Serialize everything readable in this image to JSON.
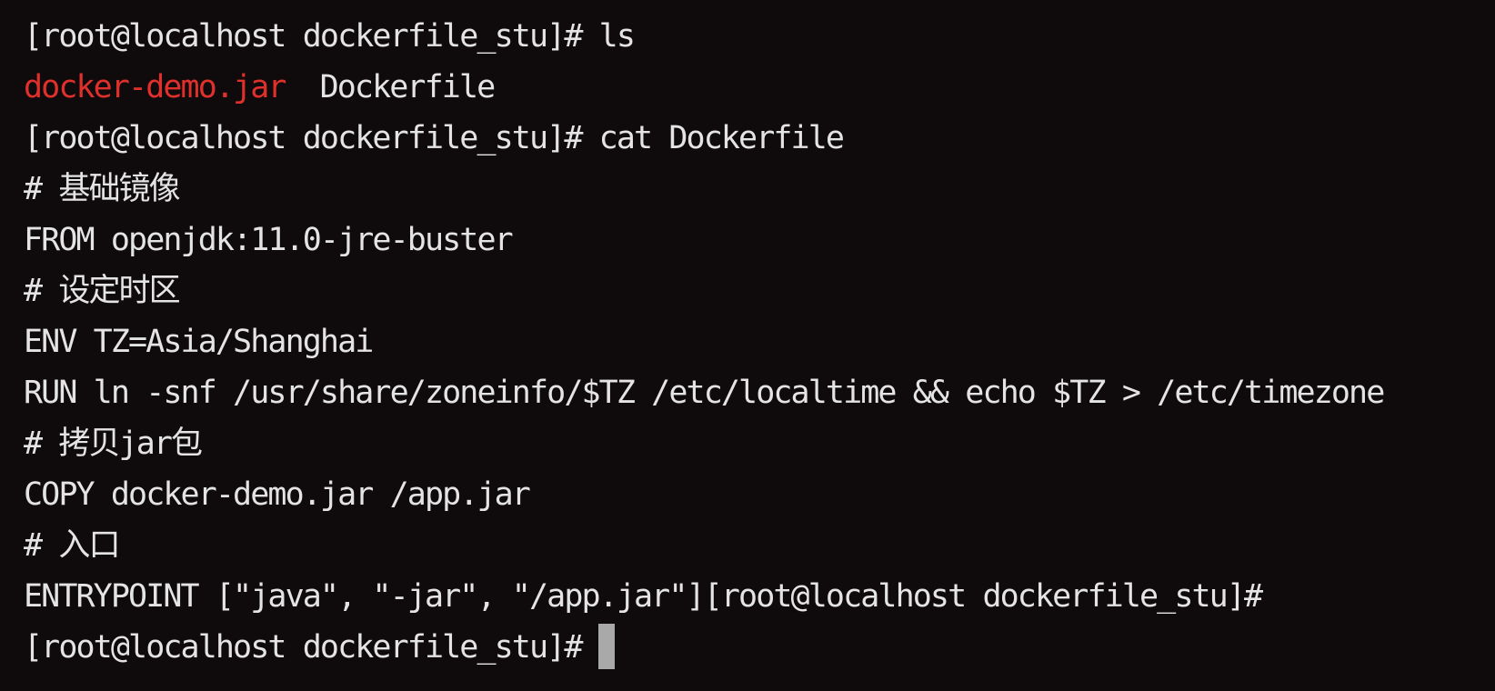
{
  "terminal": {
    "lines": [
      "[root@localhost dockerfile_stu]# ls",
      "docker-demo.jar",
      "Dockerfile",
      "[root@localhost dockerfile_stu]# cat Dockerfile",
      "# 基础镜像",
      "FROM openjdk:11.0-jre-buster",
      "# 设定时区",
      "ENV TZ=Asia/Shanghai",
      "RUN ln -snf /usr/share/zoneinfo/$TZ /etc/localtime && echo $TZ > /etc/timezone",
      "# 拷贝jar包",
      "COPY docker-demo.jar /app.jar",
      "# 入口",
      "ENTRYPOINT [\"java\", \"-jar\", \"/app.jar\"][root@localhost dockerfile_stu]#",
      "[root@localhost dockerfile_stu]#"
    ],
    "colors": {
      "background": "#0f0a0b",
      "text": "#e4e4e4",
      "highlight_file": "#e0302c",
      "cursor": "#a9a9a9"
    }
  }
}
